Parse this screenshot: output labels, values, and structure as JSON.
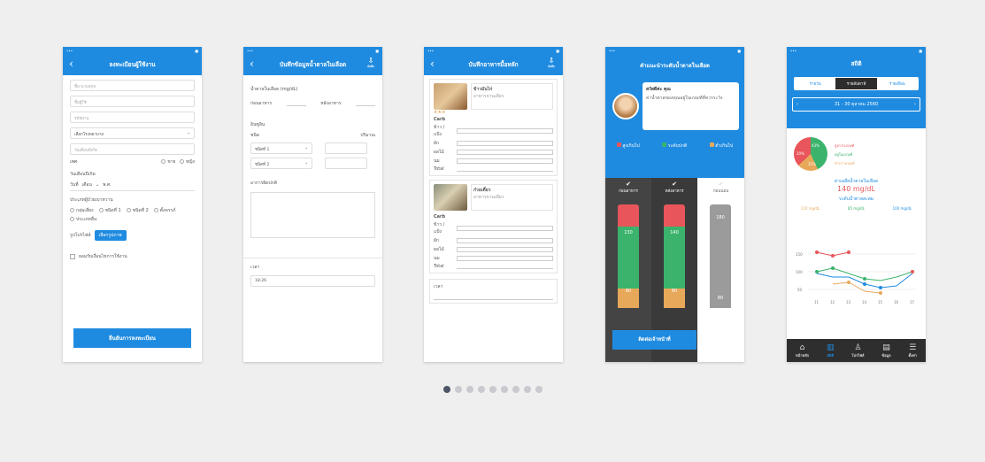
{
  "colors": {
    "primary": "#1f8be0",
    "red": "#e8555a",
    "green": "#3bb36c",
    "orange": "#e8a85a",
    "gray": "#9b9b9b",
    "dark": "#3c3c3c"
  },
  "carousel": {
    "total": 9,
    "active": 0
  },
  "screens": [
    {
      "title": "ลงทะเบียนผู้ใช้งาน",
      "fields": [
        "ชื่อ-นามสกุล",
        "ชื่อผู้ใช้",
        "รหัสผ่าน",
        "เลือกโรงพยาบาล",
        "วันเดือนปีเกิด"
      ],
      "sex_label": "เพศ",
      "sex_options": [
        "ชาย",
        "หญิง"
      ],
      "birth_label": "วันเดือนปีเกิด",
      "birth_day": "วันที่",
      "birth_month": "เดือน",
      "birth_year": "พ.ศ.",
      "group_label": "ประเภทผู้ป่วยเบาหวาน",
      "group_options": [
        "กลุ่มเสี่ยง",
        "ชนิดที่ 1",
        "ชนิดที่ 2",
        "ตั้งครรภ์",
        "ประเภทอื่น"
      ],
      "photo_label": "รูปโปรไฟล์",
      "photo_button": "เลือกรูปภาพ",
      "consent": "ยอมรับเงื่อนไขการใช้งาน",
      "submit": "ยืนยันการลงทะเบียน"
    },
    {
      "title": "บันทึกข้อมูลน้ำตาลในเลือด",
      "save": "บันทึก",
      "sugar_label": "น้ำตาลในเลือด (mg/dL)",
      "before": "ก่อนอาหาร",
      "after": "หลังอาหาร",
      "insulin_label": "อินซูลิน",
      "insulin_type": "ชนิด",
      "insulin_amount": "ปริมาณ",
      "insulin_options": [
        "ชนิดที่ 1",
        "ชนิดที่ 2"
      ],
      "note_label": "อาการผิดปกติ",
      "time_label": "เวลา",
      "time_value": "18:26"
    },
    {
      "title": "บันทึกอาหารมื้อหลัก",
      "save": "บันทึก",
      "items": [
        {
          "name": "ข้าวมันไก่",
          "desc": "อาหารจานเดียว",
          "rating": "★★★",
          "carbs": "Carb",
          "fields": [
            "ข้าว / แป้ง",
            "ผัก",
            "ผลไม้",
            "นม",
            "อื่นๆ"
          ],
          "total": "Total"
        },
        {
          "name": "ก๋วยเตี๋ยว",
          "desc": "อาหารจานเดียว",
          "rating": "",
          "carbs": "Carb",
          "fields": [
            "ข้าว / แป้ง",
            "ผัก",
            "ผลไม้",
            "นม",
            "อื่นๆ"
          ],
          "total": "Total"
        }
      ],
      "time_label": "เวลา"
    },
    {
      "title": "คำแนะนำระดับน้ำตาลในเลือด",
      "bubble_title": "สวัสดีค่ะ คุณ",
      "bubble_text": "ค่าน้ำตาลของคุณอยู่ในเกณฑ์ที่ควรระวัง",
      "legend": [
        "สูงเกินไป",
        "ระดับปกติ",
        "ต่ำเกินไป"
      ],
      "bars": [
        {
          "label": "ก่อนอาหาร",
          "value": "130"
        },
        {
          "label": "หลังอาหาร",
          "value": "140"
        },
        {
          "label": "ก่อนนอน",
          "value": "180"
        }
      ],
      "low_value": "80",
      "cta": "ติดต่อเจ้าหน้าที่"
    },
    {
      "title": "สถิติ",
      "tabs": [
        "รายวัน",
        "รายสัปดาห์",
        "รายเดือน"
      ],
      "range": "31 - 30 ตุลาคม 2560",
      "pie": [
        {
          "value": "43%"
        },
        {
          "value": "20%"
        },
        {
          "value": "35%"
        }
      ],
      "pie_legend": [
        "สูงกว่าเกณฑ์",
        "อยู่ในเกณฑ์",
        "ต่ำกว่าเกณฑ์"
      ],
      "avg_label": "ค่าเฉลี่ยน้ำตาลในเลือด",
      "avg_value": "140 mg/dL",
      "level_label": "ระดับน้ำตาลสะสม",
      "levels": [
        "110 mg/dL",
        "85 mg/dL",
        "100 mg/dL"
      ],
      "chart_y": [
        "150",
        "100",
        "50"
      ],
      "chart_x": [
        "11",
        "12",
        "13",
        "14",
        "15",
        "16",
        "17"
      ],
      "nav": [
        "หน้าหลัก",
        "สถิติ",
        "โปรไฟล์",
        "ข้อมูล",
        "ตั้งค่า"
      ]
    }
  ]
}
